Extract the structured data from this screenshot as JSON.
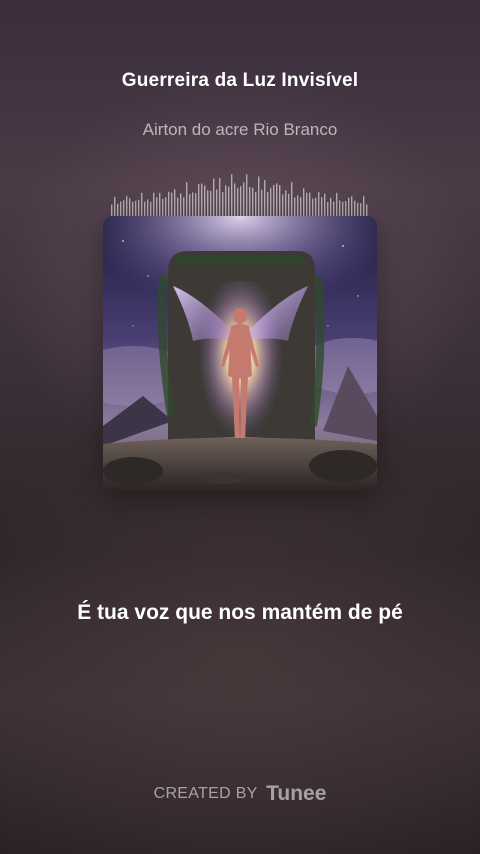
{
  "song": {
    "title": "Guerreira da Luz Invisível",
    "artist": "Airton do acre Rio Branco"
  },
  "lyrics": {
    "current_line": "É tua voz que nos mantém de pé"
  },
  "footer": {
    "created_by": "CREATED BY",
    "brand": "Tunee"
  },
  "colors": {
    "background_top": "#3b2d3c",
    "background_bottom": "#2b2224",
    "text_primary": "#ffffff",
    "text_secondary": "#a99fa6"
  },
  "icons": {
    "waveform": "audio-waveform-icon"
  }
}
